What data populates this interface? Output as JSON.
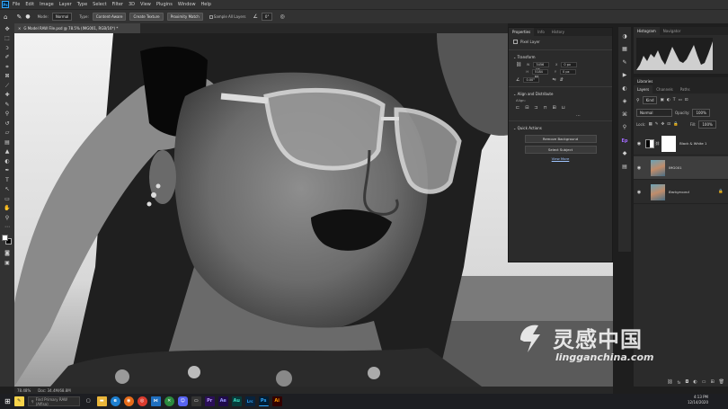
{
  "menubar": {
    "app_logo": "Ps",
    "items": [
      "File",
      "Edit",
      "Image",
      "Layer",
      "Type",
      "Select",
      "Filter",
      "3D",
      "View",
      "Plugins",
      "Window",
      "Help"
    ]
  },
  "options": {
    "mode_label": "Mode:",
    "mode_value": "Normal",
    "type_label": "Type:",
    "btn_content_aware": "Content-Aware",
    "btn_create_texture": "Create Texture",
    "btn_proximity_match": "Proximity Match",
    "sample_all_layers": "Sample All Layers",
    "angle_value": "0°"
  },
  "document": {
    "tab_title": "G Model RAW File.psd @ 78.5% (IMG001, RGB/16*) *",
    "zoom": "78.48%",
    "doc_info": "Doc: 34.4M/68.8M"
  },
  "properties": {
    "tabs": [
      "Properties",
      "Info",
      "History"
    ],
    "pixel_layer": "Pixel Layer",
    "transform_title": "Transform",
    "w_label": "W",
    "w_value": "3456 px",
    "h_label": "H",
    "h_value": "5184 px",
    "x_label": "X",
    "x_value": "0 px",
    "y_label": "Y",
    "y_value": "0 px",
    "angle_value": "0.00°",
    "align_title": "Align and Distribute",
    "align_label": "Align:",
    "quick_actions_title": "Quick Actions",
    "btn_remove_bg": "Remove Background",
    "btn_select_subject": "Select Subject",
    "view_more": "View More"
  },
  "right_panels": {
    "histogram_tab": "Histogram",
    "navigator_tab": "Navigator",
    "libraries_tab": "Libraries",
    "layers_tabs": [
      "Layers",
      "Channels",
      "Paths"
    ],
    "kind_label": "Kind",
    "blend_mode": "Normal",
    "opacity_label": "Opacity:",
    "opacity_value": "100%",
    "lock_label": "Lock:",
    "fill_label": "Fill:",
    "fill_value": "100%",
    "layers": [
      {
        "name": "Black & White 1",
        "selected": false
      },
      {
        "name": "IMG001",
        "selected": true
      },
      {
        "name": "Background",
        "selected": false
      }
    ]
  },
  "taskbar": {
    "search_placeholder": "Find Primary RAW (Alfisa)",
    "apps": [
      {
        "label": "Pr",
        "color": "#2a0f57",
        "text": "#b99cff"
      },
      {
        "label": "Ae",
        "color": "#1f0a4a",
        "text": "#9999ff"
      },
      {
        "label": "Au",
        "color": "#063b3b",
        "text": "#3ee0c4"
      },
      {
        "label": "Lrc",
        "color": "#08233d",
        "text": "#31a8ff"
      },
      {
        "label": "Ps",
        "color": "#001e36",
        "text": "#31a8ff"
      },
      {
        "label": "Ai",
        "color": "#330000",
        "text": "#ff9a00"
      }
    ],
    "time": "4:13 PM",
    "date": "12/14/2020"
  },
  "watermark": {
    "chinese": "灵感中国",
    "english": "lingganchina.com"
  },
  "colors": {
    "ps_blue": "#31a8ff",
    "selected_layer": "#3e3e3e",
    "panel_bg": "#2b2b2b"
  }
}
